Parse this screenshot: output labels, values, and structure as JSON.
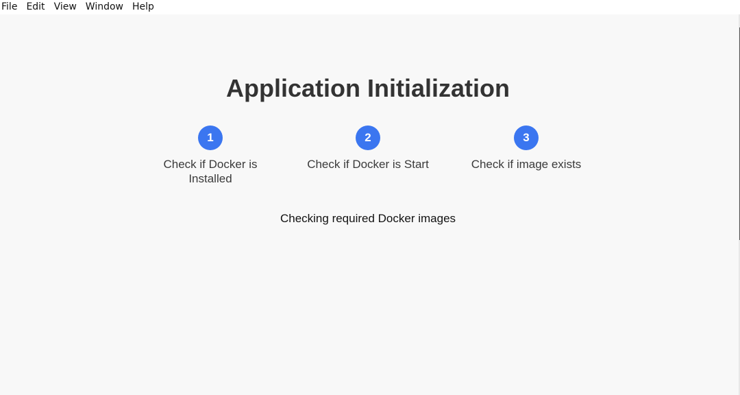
{
  "menu": {
    "items": [
      "File",
      "Edit",
      "View",
      "Window",
      "Help"
    ]
  },
  "title": "Application Initialization",
  "steps": [
    {
      "number": "1",
      "label": "Check if Docker is Installed"
    },
    {
      "number": "2",
      "label": "Check if Docker is Start"
    },
    {
      "number": "3",
      "label": "Check if image exists"
    }
  ],
  "status": "Checking required Docker images",
  "colors": {
    "step_accent": "#3b76f0",
    "background": "#f8f8f8",
    "menu_background": "#ffffff"
  }
}
